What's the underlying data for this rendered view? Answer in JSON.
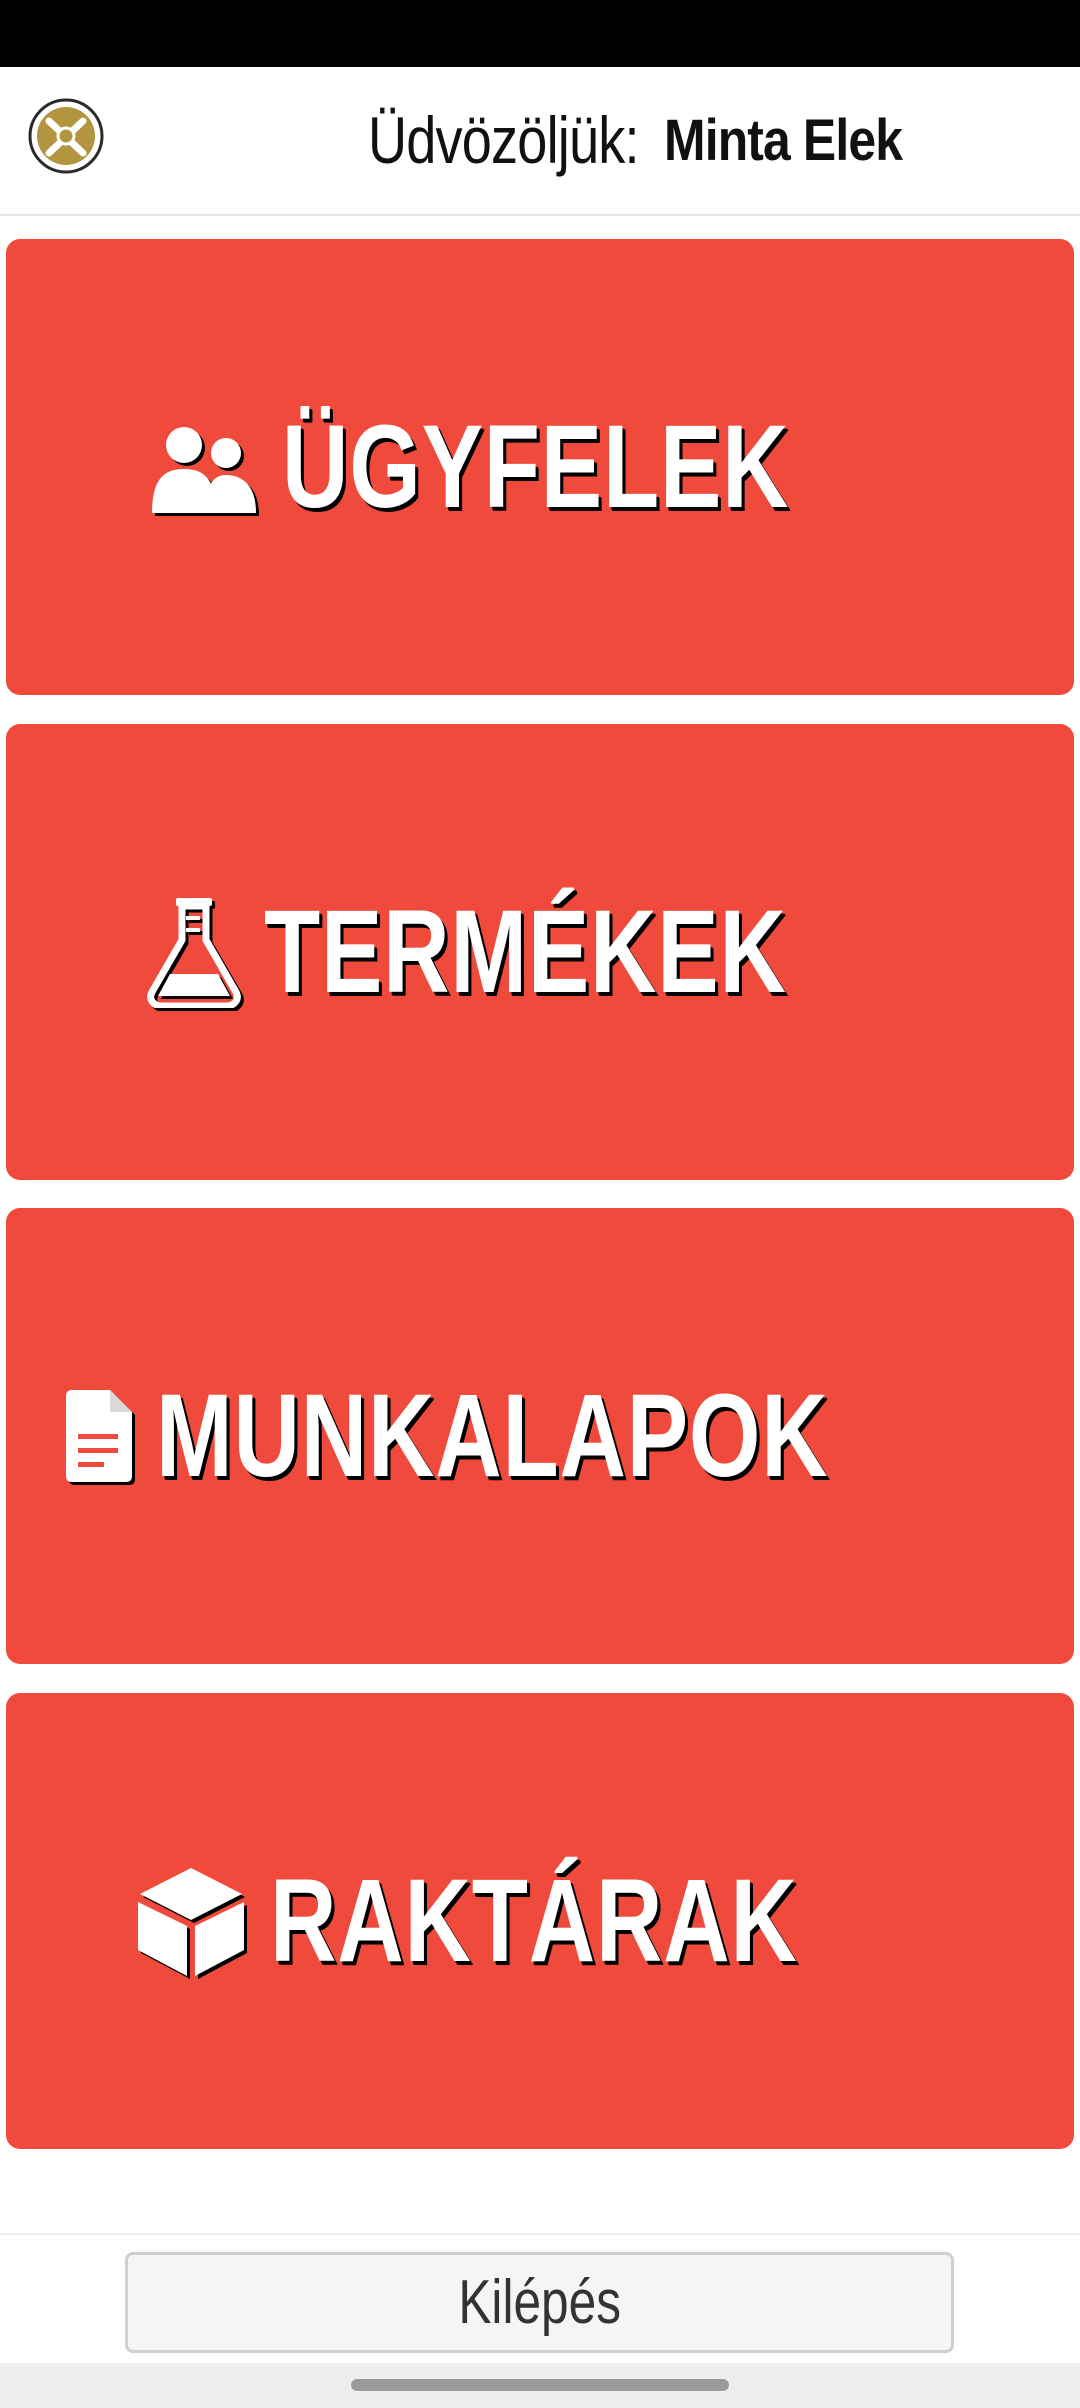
{
  "header": {
    "logo_icon": "tools-emblem-icon",
    "welcome_label": "Üdvözöljük:",
    "user_name": "Minta Elek"
  },
  "menu": {
    "tiles": [
      {
        "label": "ÜGYFELEK",
        "icon": "users-icon"
      },
      {
        "label": "TERMÉKEK",
        "icon": "flask-icon"
      },
      {
        "label": "MUNKALAPOK",
        "icon": "document-icon"
      },
      {
        "label": "RAKTÁRAK",
        "icon": "box-icon"
      }
    ]
  },
  "footer": {
    "logout_label": "Kilépés"
  },
  "colors": {
    "tile_background": "#ef4a3c",
    "logo_gold": "#b3953f"
  }
}
